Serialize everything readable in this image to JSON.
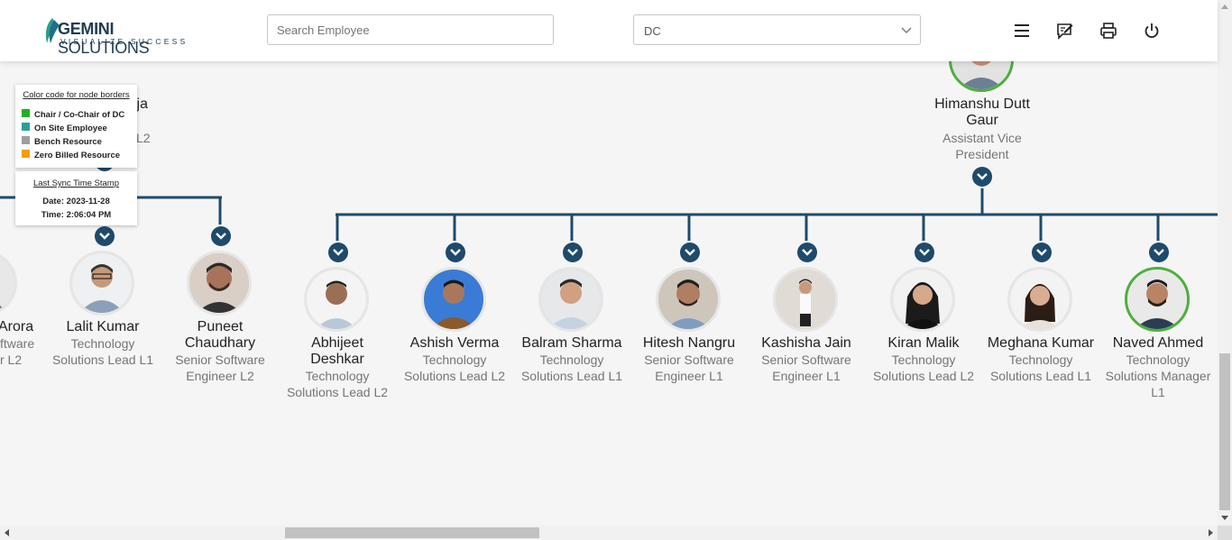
{
  "header": {
    "logo": {
      "name_bold": "GEMINI",
      "name_rest": " SOLUTIONS",
      "tagline": "VISUALIZE SUCCESS"
    },
    "search": {
      "placeholder": "Search Employee",
      "value": ""
    },
    "department_select": {
      "selected": "DC"
    },
    "icons": [
      "menu-icon",
      "feedback-icon",
      "print-icon",
      "power-icon"
    ]
  },
  "legend": {
    "heading": "Color code for node borders",
    "items": [
      {
        "label": "Chair / Co-Chair of DC",
        "color": "#22b022"
      },
      {
        "label": "On Site Employee",
        "color": "#2aa198"
      },
      {
        "label": "Bench Resource",
        "color": "#9e9e9e"
      },
      {
        "label": "Zero Billed Resource",
        "color": "#f0a000"
      }
    ]
  },
  "sync": {
    "heading": "Last Sync Time Stamp",
    "date": "Date: 2023-11-28",
    "time": "Time: 2:06:04 PM"
  },
  "colors": {
    "connector": "#1e4a6b",
    "chair_border": "#4caf3c",
    "default_border": "#e6e6e6"
  },
  "partial_nodes": {
    "top_left_name_fragment": "ija",
    "top_left_title_fragment": "L2",
    "left_name_fragment": "Arora",
    "left_title_line1": "ftware",
    "left_title_line2": "r L2"
  },
  "managers": {
    "himanshu": {
      "name": "Himanshu Dutt Gaur",
      "title": "Assistant Vice President"
    }
  },
  "left_group": [
    {
      "name": "Lalit Kumar",
      "title": "Technology Solutions Lead L1"
    },
    {
      "name": "Puneet Chaudhary",
      "title": "Senior Software Engineer L2"
    }
  ],
  "reports": [
    {
      "name": "Abhijeet Deshkar",
      "title": "Technology Solutions Lead L2"
    },
    {
      "name": "Ashish Verma",
      "title": "Technology Solutions Lead L2"
    },
    {
      "name": "Balram Sharma",
      "title": "Technology Solutions Lead L1"
    },
    {
      "name": "Hitesh Nangru",
      "title": "Senior Software Engineer L1"
    },
    {
      "name": "Kashisha Jain",
      "title": "Senior Software Engineer L1"
    },
    {
      "name": "Kiran Malik",
      "title": "Technology Solutions Lead L2"
    },
    {
      "name": "Meghana Kumar",
      "title": "Technology Solutions Lead L1"
    },
    {
      "name": "Naved Ahmed",
      "title": "Technology Solutions Manager L1"
    }
  ],
  "scroll": {
    "vertical_position": 0.72,
    "horizontal_position": 0.24
  }
}
